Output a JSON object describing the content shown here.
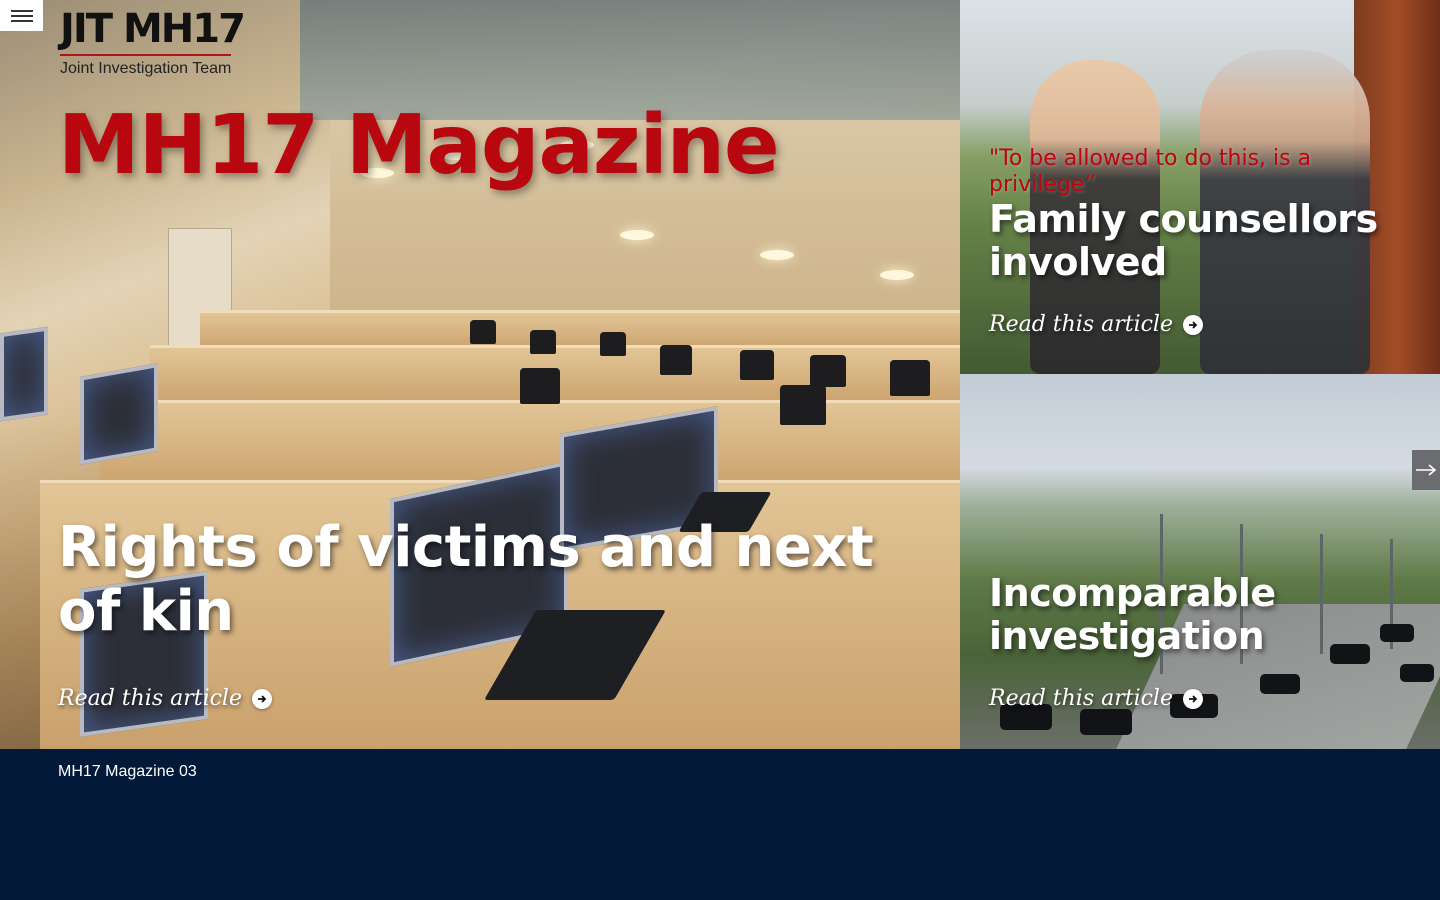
{
  "logo": {
    "title": "JIT MH17",
    "subtitle": "Joint Investigation Team"
  },
  "magazine": {
    "title": "MH17 Magazine",
    "issue_label": "MH17 Magazine 03"
  },
  "articles": [
    {
      "headline": "Rights of victims and next of kin",
      "read_more": "Read this article"
    },
    {
      "quote": "\"To be allowed to do this, is a privilege”",
      "headline": "Family counsellors involved",
      "read_more": "Read this article"
    },
    {
      "headline": "Incomparable investigation",
      "read_more": "Read this article"
    }
  ],
  "icons": {
    "menu": "hamburger-icon",
    "next": "arrow-right-icon",
    "read_more": "circle-arrow-right-icon"
  },
  "colors": {
    "accent_red": "#b8070f",
    "footer_navy": "#02193a",
    "next_button": "#6b6c6f"
  }
}
